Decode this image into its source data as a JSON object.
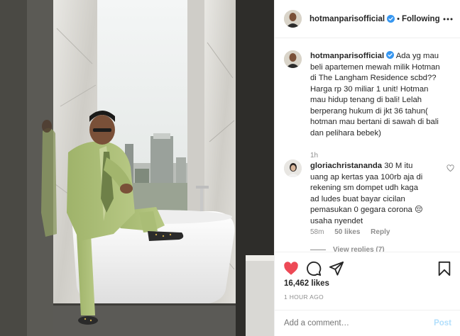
{
  "post": {
    "username": "hotmanparisofficial",
    "follow_state": "Following",
    "separator": "•",
    "photo_alt": "post-photo"
  },
  "caption": {
    "username": "hotmanparisofficial",
    "text": "Ada yg mau\nbeli apartemen mewah milik Hotman\ndi The Langham Residence scbd??\nHarga rp 30 miliar 1 unit! Hotman\nmau hidup tenang di bali! Lelah\nberperang hukum di jkt 36 tahun(\nhotman mau bertani di sawah di bali\ndan pelihara bebek)",
    "time": "1h"
  },
  "comment": {
    "username": "gloriachristananda",
    "text": "30 M itu\nuang ap kertas yaa 100rb aja di\nrekening sm dompet udh kaga\nad ludes buat bayar cicilan\npemasukan 0 gegara corona 😔\nusaha nyendet",
    "time": "58m",
    "likes": "50 likes",
    "reply": "Reply"
  },
  "view_replies": "View replies (7)",
  "likes": "16,462 likes",
  "post_time": "1 HOUR AGO",
  "add_comment": {
    "placeholder": "Add a comment…",
    "post_label": "Post"
  },
  "icons": {
    "verified": "verified-badge-icon",
    "more": "more-options-icon",
    "like": "heart-filled-icon",
    "comment": "comment-icon",
    "share": "share-icon",
    "save": "bookmark-icon"
  },
  "colors": {
    "accent": "#0095f6",
    "like_red": "#ed4956",
    "muted": "#8e8e8e",
    "post_disabled": "#b2dffc"
  }
}
